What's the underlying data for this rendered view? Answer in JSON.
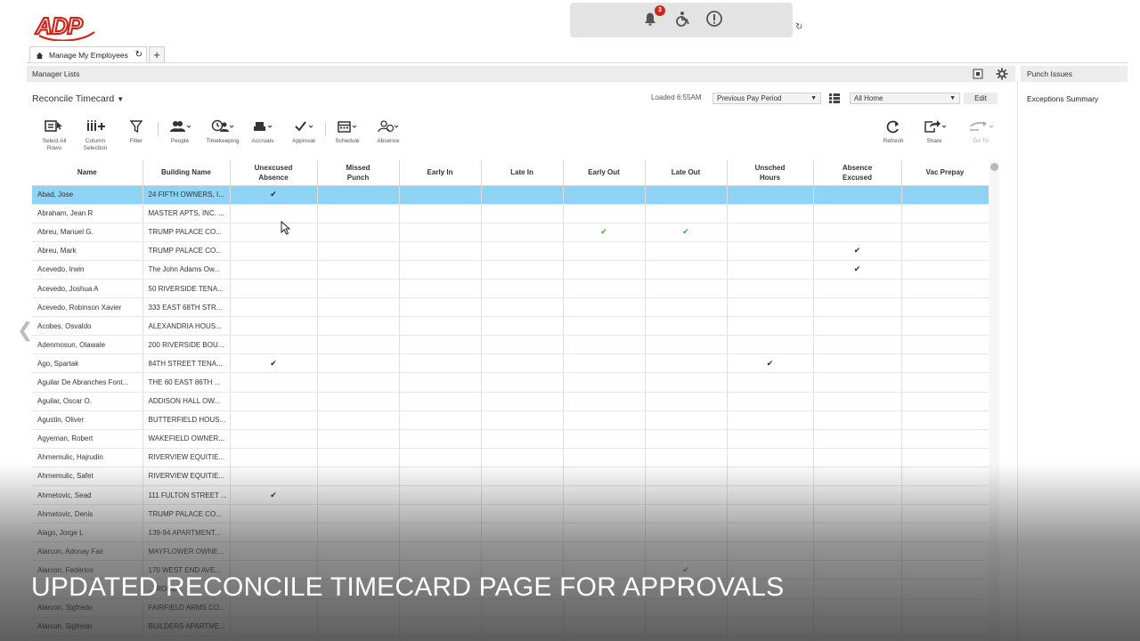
{
  "brand": {
    "logo_text": "ADP",
    "color": "#d0271d"
  },
  "notifications": {
    "badge_count": "3",
    "icons": [
      "bell-icon",
      "accessibility-icon",
      "alert-icon"
    ]
  },
  "tabs": [
    {
      "label": "Manage My Employees"
    }
  ],
  "manager_lists": {
    "label": "Manager Lists"
  },
  "right_panel": {
    "header": "Punch Issues",
    "item": "Exceptions Summary"
  },
  "page": {
    "title": "Reconcile Timecard",
    "loaded": "Loaded 6:55AM",
    "period_select": "Previous Pay Period",
    "location_select": "All Home",
    "edit_label": "Edit"
  },
  "toolbar": [
    {
      "name": "select-all-rows",
      "label": "Select All Rows",
      "icon": "select-all-icon"
    },
    {
      "name": "column-selection",
      "label": "Column Selection",
      "icon": "column-icon"
    },
    {
      "name": "filter",
      "label": "Filter",
      "icon": "filter-icon"
    },
    {
      "name": "people",
      "label": "People",
      "icon": "people-icon"
    },
    {
      "name": "timekeeping",
      "label": "Timekeeping",
      "icon": "timekeeping-icon"
    },
    {
      "name": "accruals",
      "label": "Accruals",
      "icon": "accruals-icon"
    },
    {
      "name": "approval",
      "label": "Approval",
      "icon": "check-icon"
    },
    {
      "name": "schedule",
      "label": "Schedule",
      "icon": "calendar-icon"
    },
    {
      "name": "absence",
      "label": "Absence",
      "icon": "absence-icon"
    },
    {
      "name": "refresh",
      "label": "Refresh",
      "icon": "refresh-icon"
    },
    {
      "name": "share",
      "label": "Share",
      "icon": "share-icon"
    },
    {
      "name": "go-to",
      "label": "Go To",
      "icon": "go-to-icon"
    }
  ],
  "table": {
    "columns": [
      "Name",
      "Building Name",
      "Unexcused Absence",
      "Missed Punch",
      "Early In",
      "Late In",
      "Early Out",
      "Late Out",
      "Unsched Hours",
      "Absence Excused",
      "Vac Prepay"
    ],
    "rows": [
      {
        "name": "Abad, Jose",
        "building": "24 FIFTH OWNERS, I...",
        "checks": {
          "unexcused": "check"
        },
        "selected": true
      },
      {
        "name": "Abraham, Jean R",
        "building": "MASTER APTS, INC. ...",
        "checks": {}
      },
      {
        "name": "Abreu, Manuel G.",
        "building": "TRUMP PALACE CO...",
        "checks": {
          "early_out": "green",
          "late_out": "green"
        }
      },
      {
        "name": "Abreu, Mark",
        "building": "TRUMP PALACE CO...",
        "checks": {
          "absence_excused": "check"
        }
      },
      {
        "name": "Acevedo, Irwin",
        "building": "The John Adams Ow...",
        "checks": {
          "absence_excused": "check"
        }
      },
      {
        "name": "Acevedo, Joshua A",
        "building": "50 RIVERSIDE TENA...",
        "checks": {}
      },
      {
        "name": "Acevedo, Robinson Xavier",
        "building": "333 EAST 68TH STR...",
        "checks": {}
      },
      {
        "name": "Acobes, Osvaldo",
        "building": "ALEXANDRIA HOUS...",
        "checks": {}
      },
      {
        "name": "Adenmosun, Olawale",
        "building": "200 RIVERSIDE BOU...",
        "checks": {}
      },
      {
        "name": "Ago, Spartak",
        "building": "84TH STREET TENA...",
        "checks": {
          "unexcused": "check",
          "unsched": "check"
        }
      },
      {
        "name": "Aguilar De Abranches Font...",
        "building": "THE 60 EAST 86TH ...",
        "checks": {}
      },
      {
        "name": "Aguilar, Oscar O.",
        "building": "ADDISON HALL OW...",
        "checks": {}
      },
      {
        "name": "Agustin, Oliver",
        "building": "BUTTERFIELD HOUS...",
        "checks": {}
      },
      {
        "name": "Agyeman, Robert",
        "building": "WAKEFIELD OWNER...",
        "checks": {}
      },
      {
        "name": "Ahmemulic, Hajrudin",
        "building": "RIVERVIEW EQUITIE...",
        "checks": {}
      },
      {
        "name": "Ahmemulic, Safet",
        "building": "RIVERVIEW EQUITIE...",
        "checks": {}
      },
      {
        "name": "Ahmetovic, Sead",
        "building": "111 FULTON STREET ...",
        "checks": {
          "unexcused": "check"
        }
      },
      {
        "name": "Ahmetovic, Denis",
        "building": "TRUMP PALACE CO...",
        "checks": {}
      },
      {
        "name": "Alago, Jorge L",
        "building": "139-94 APARTMENT...",
        "checks": {}
      },
      {
        "name": "Alarcon, Adonay Fair",
        "building": "MAYFLOWER OWNE...",
        "checks": {}
      },
      {
        "name": "Alarcon, Federico",
        "building": "170 WEST END AVE...",
        "checks": {
          "late_out": "green"
        }
      },
      {
        "name": "",
        "building": "... ROND...",
        "checks": {}
      },
      {
        "name": "Alarcon, Sigfredo",
        "building": "FAIRFIELD ARMS CO...",
        "checks": {}
      },
      {
        "name": "Alarcon, Sigfredo",
        "building": "BUILDERS APARTME...",
        "checks": {}
      }
    ]
  },
  "caption": "UPDATED RECONCILE TIMECARD PAGE FOR APPROVALS"
}
